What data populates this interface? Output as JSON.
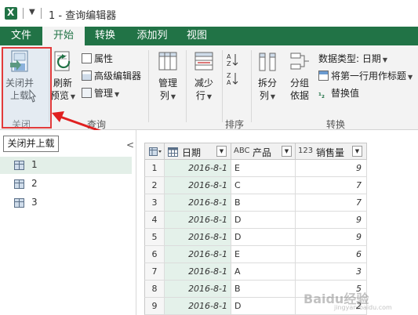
{
  "window": {
    "title": "1 - 查询编辑器"
  },
  "tabs": [
    {
      "label": "文件"
    },
    {
      "label": "开始"
    },
    {
      "label": "转换"
    },
    {
      "label": "添加列"
    },
    {
      "label": "视图"
    }
  ],
  "ribbon": {
    "close_group": {
      "label": "关闭",
      "close_load_line1": "关闭并",
      "close_load_line2": "上载"
    },
    "query_group": {
      "label": "查询",
      "refresh_line1": "刷新",
      "refresh_line2": "预览",
      "properties": "属性",
      "advanced_editor": "高级编辑器",
      "manage": "管理"
    },
    "manage_cols": {
      "line1": "管理",
      "line2": "列"
    },
    "reduce_rows": {
      "line1": "减少",
      "line2": "行"
    },
    "sort_group": {
      "label": "排序"
    },
    "transform_group": {
      "label": "转换",
      "split_line1": "拆分",
      "split_line2": "列",
      "group_line1": "分组",
      "group_line2": "依据",
      "data_type": "数据类型: 日期",
      "first_row_header": "将第一行用作标题",
      "replace_values": "替换值"
    }
  },
  "tooltip": {
    "text": "关闭并上载"
  },
  "queries": [
    {
      "label": "1"
    },
    {
      "label": "2"
    },
    {
      "label": "3"
    }
  ],
  "grid": {
    "columns": [
      {
        "type_badge": "",
        "label": "日期"
      },
      {
        "type_badge": "ABC",
        "label": "产品"
      },
      {
        "type_badge": "123",
        "label": "销售量"
      }
    ],
    "rows": [
      {
        "num": "1",
        "date": "2016-8-1",
        "product": "E",
        "sales": "9"
      },
      {
        "num": "2",
        "date": "2016-8-1",
        "product": "C",
        "sales": "7"
      },
      {
        "num": "3",
        "date": "2016-8-1",
        "product": "B",
        "sales": "7"
      },
      {
        "num": "4",
        "date": "2016-8-1",
        "product": "D",
        "sales": "9"
      },
      {
        "num": "5",
        "date": "2016-8-1",
        "product": "D",
        "sales": "9"
      },
      {
        "num": "6",
        "date": "2016-8-1",
        "product": "E",
        "sales": "6"
      },
      {
        "num": "7",
        "date": "2016-8-1",
        "product": "A",
        "sales": "3"
      },
      {
        "num": "8",
        "date": "2016-8-1",
        "product": "B",
        "sales": "5"
      },
      {
        "num": "9",
        "date": "2016-8-1",
        "product": "D",
        "sales": "2"
      }
    ]
  },
  "watermark": {
    "text": "Baidu经验",
    "sub": "jingyan.baidu.com"
  },
  "colors": {
    "excel_green": "#217346",
    "highlight_red": "#e23b3b"
  }
}
